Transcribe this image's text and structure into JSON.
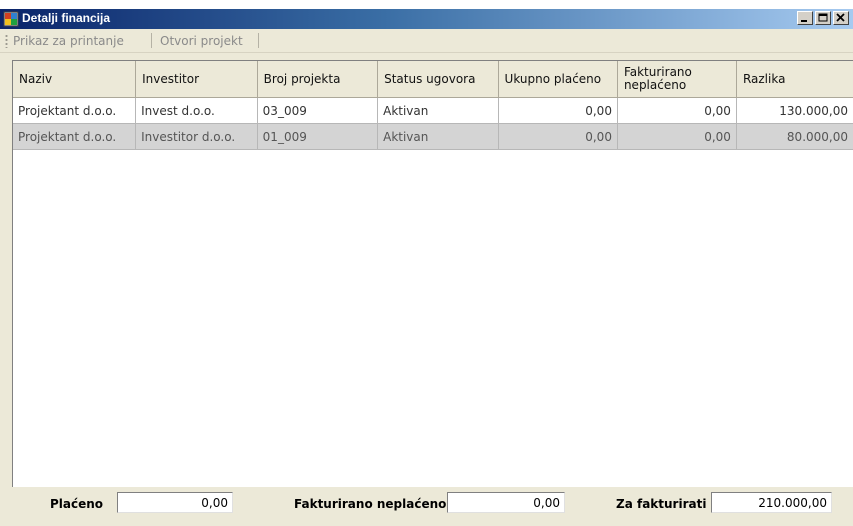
{
  "window": {
    "title": "Detalji financija",
    "controls": [
      "minimize",
      "maximize",
      "close"
    ]
  },
  "toolbar": {
    "items": [
      {
        "label": "Prikaz za printanje"
      },
      {
        "label": "Otvori projekt"
      }
    ]
  },
  "table": {
    "headers": [
      "Naziv",
      "Investitor",
      "Broj projekta",
      "Status ugovora",
      "Ukupno plaćeno",
      "Fakturirano neplaćeno",
      "Razlika"
    ],
    "rows": [
      [
        "Projektant d.o.o.",
        "Invest d.o.o.",
        "03_009",
        "Aktivan",
        "0,00",
        "0,00",
        "130.000,00"
      ],
      [
        "Projektant d.o.o.",
        "Investitor d.o.o.",
        "01_009",
        "Aktivan",
        "0,00",
        "0,00",
        "80.000,00"
      ]
    ],
    "selected_row": 1
  },
  "footer": {
    "placeno_label": "Plaćeno",
    "placeno_value": "0,00",
    "fakturirano_label": "Fakturirano neplaćeno",
    "fakturirano_value": "0,00",
    "zafakturirati_label": "Za fakturirati",
    "zafakturirati_value": "210.000,00"
  }
}
